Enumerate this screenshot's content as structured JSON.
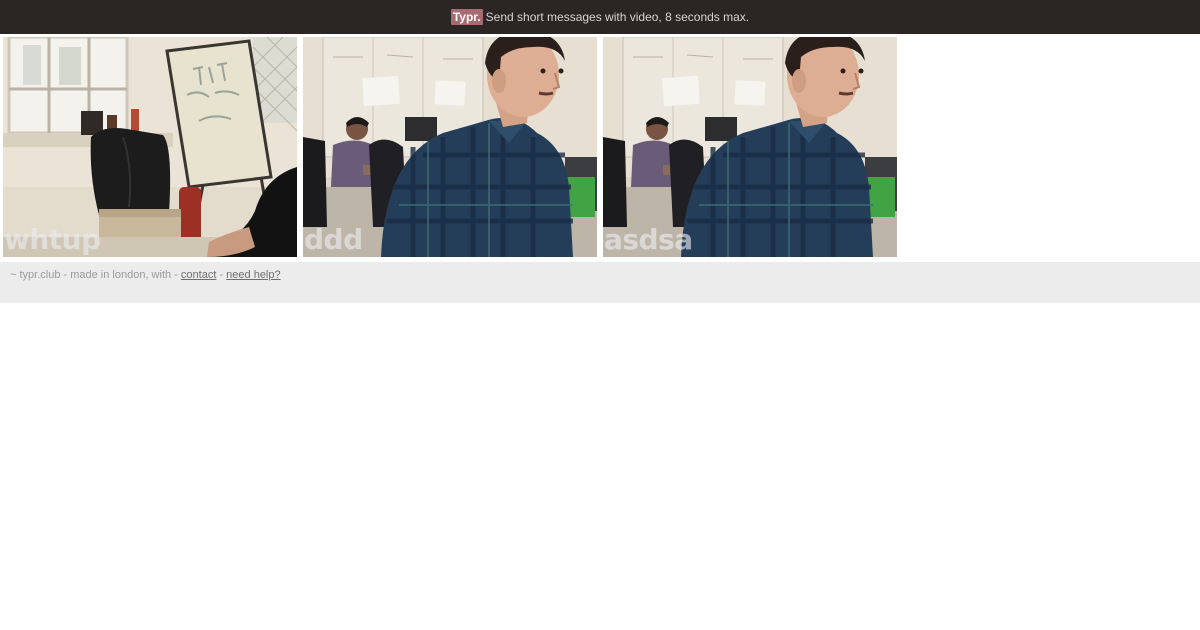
{
  "header": {
    "brand": "Typr.",
    "tagline": "Send short messages with video, 8 seconds max."
  },
  "messages": [
    {
      "label": "whtup",
      "scene": "office-whiteboard"
    },
    {
      "label": "ddd",
      "scene": "man-plaid-shirt-office"
    },
    {
      "label": "asdsa",
      "scene": "man-plaid-shirt-office"
    }
  ],
  "footer": {
    "prefix": "~ typr.club - made in london, with -",
    "contact_label": "contact",
    "separator": "-",
    "help_label": "need help?"
  },
  "colors": {
    "topbar": "#2b2624",
    "brand_badge": "#a86a73",
    "footer_bg": "#ececec"
  }
}
